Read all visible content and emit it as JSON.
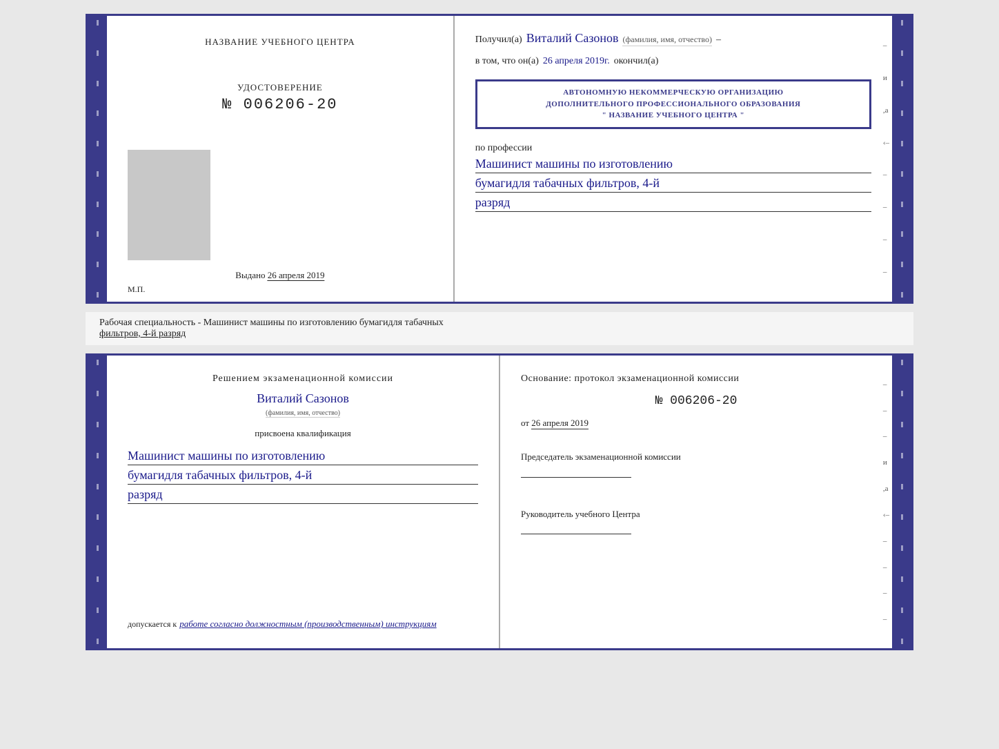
{
  "top_cert": {
    "left": {
      "title": "НАЗВАНИЕ УЧЕБНОГО ЦЕНТРА",
      "cert_label": "УДОСТОВЕРЕНИЕ",
      "cert_number": "№ 006206-20",
      "issued_label": "Выдано",
      "issued_date": "26 апреля 2019",
      "mp_label": "М.П."
    },
    "right": {
      "received_label": "Получил(а)",
      "full_name": "Виталий Сазонов",
      "name_subtitle": "(фамилия, имя, отчество)",
      "in_that_prefix": "в том, что он(а)",
      "date_handwritten": "26 апреля 2019г.",
      "finished_label": "окончил(а)",
      "stamp_line1": "АВТОНОМНУЮ НЕКОММЕРЧЕСКУЮ ОРГАНИЗАЦИЮ",
      "stamp_line2": "ДОПОЛНИТЕЛЬНОГО ПРОФЕССИОНАЛЬНОГО ОБРАЗОВАНИЯ",
      "stamp_line3": "\" НАЗВАНИЕ УЧЕБНОГО ЦЕНТРА \"",
      "profession_label": "по профессии",
      "profession_line1": "Машинист машины по изготовлению",
      "profession_line2": "бумагидля табачных фильтров, 4-й",
      "profession_line3": "разряд",
      "side_marks": [
        "–",
        "и",
        ",а",
        "‹–",
        "–",
        "–",
        "–",
        "–"
      ]
    }
  },
  "bottom_specialty_text": "Рабочая специальность - Машинист машины по изготовлению бумагидля табачных",
  "bottom_specialty_underline": "фильтров, 4-й разряд",
  "bottom_cert": {
    "left": {
      "decision_title": "Решением  экзаменационной  комиссии",
      "full_name": "Виталий Сазонов",
      "name_subtitle": "(фамилия, имя, отчество)",
      "qualification_label": "присвоена квалификация",
      "qualification_line1": "Машинист машины по изготовлению",
      "qualification_line2": "бумагидля табачных фильтров, 4-й",
      "qualification_line3": "разряд",
      "allowed_label": "допускается к",
      "allowed_text": "работе согласно должностным (производственным) инструкциям"
    },
    "right": {
      "basis_title": "Основание:  протокол  экзаменационной  комиссии",
      "basis_number": "№  006206-20",
      "basis_date_prefix": "от",
      "basis_date": "26 апреля 2019",
      "chairman_label": "Председатель экзаменационной комиссии",
      "head_label": "Руководитель учебного Центра",
      "side_marks": [
        "–",
        "–",
        "–",
        "и",
        ",а",
        "‹–",
        "–",
        "–",
        "–",
        "–"
      ]
    }
  }
}
